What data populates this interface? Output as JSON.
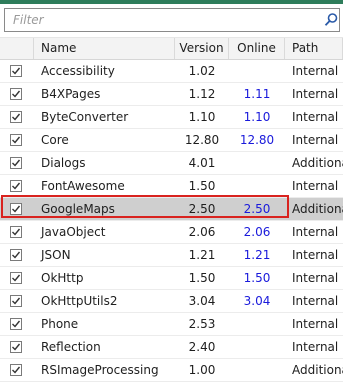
{
  "filter": {
    "placeholder": "Filter",
    "value": ""
  },
  "columns": {
    "name": "Name",
    "version": "Version",
    "online": "Online",
    "path": "Path"
  },
  "rows": [
    {
      "checked": true,
      "name": "Accessibility",
      "version": "1.02",
      "online": "",
      "path": "Internal"
    },
    {
      "checked": true,
      "name": "B4XPages",
      "version": "1.12",
      "online": "1.11",
      "path": "Internal"
    },
    {
      "checked": true,
      "name": "ByteConverter",
      "version": "1.10",
      "online": "1.10",
      "path": "Internal"
    },
    {
      "checked": true,
      "name": "Core",
      "version": "12.80",
      "online": "12.80",
      "path": "Internal"
    },
    {
      "checked": true,
      "name": "Dialogs",
      "version": "4.01",
      "online": "",
      "path": "Additional"
    },
    {
      "checked": true,
      "name": "FontAwesome",
      "version": "1.50",
      "online": "",
      "path": "Internal"
    },
    {
      "checked": true,
      "name": "GoogleMaps",
      "version": "2.50",
      "online": "2.50",
      "path": "Additional",
      "selected": true
    },
    {
      "checked": true,
      "name": "JavaObject",
      "version": "2.06",
      "online": "2.06",
      "path": "Internal"
    },
    {
      "checked": true,
      "name": "JSON",
      "version": "1.21",
      "online": "1.21",
      "path": "Internal"
    },
    {
      "checked": true,
      "name": "OkHttp",
      "version": "1.50",
      "online": "1.50",
      "path": "Internal"
    },
    {
      "checked": true,
      "name": "OkHttpUtils2",
      "version": "3.04",
      "online": "3.04",
      "path": "Internal"
    },
    {
      "checked": true,
      "name": "Phone",
      "version": "2.53",
      "online": "",
      "path": "Internal"
    },
    {
      "checked": true,
      "name": "Reflection",
      "version": "2.40",
      "online": "",
      "path": "Internal"
    },
    {
      "checked": true,
      "name": "RSImageProcessing",
      "version": "1.00",
      "online": "",
      "path": "Additional"
    }
  ],
  "colors": {
    "online_text": "#1a1adb",
    "selection_outline": "#d9231f",
    "selected_row": "#cfcfcf",
    "top_bar": "#2e7d5b"
  }
}
